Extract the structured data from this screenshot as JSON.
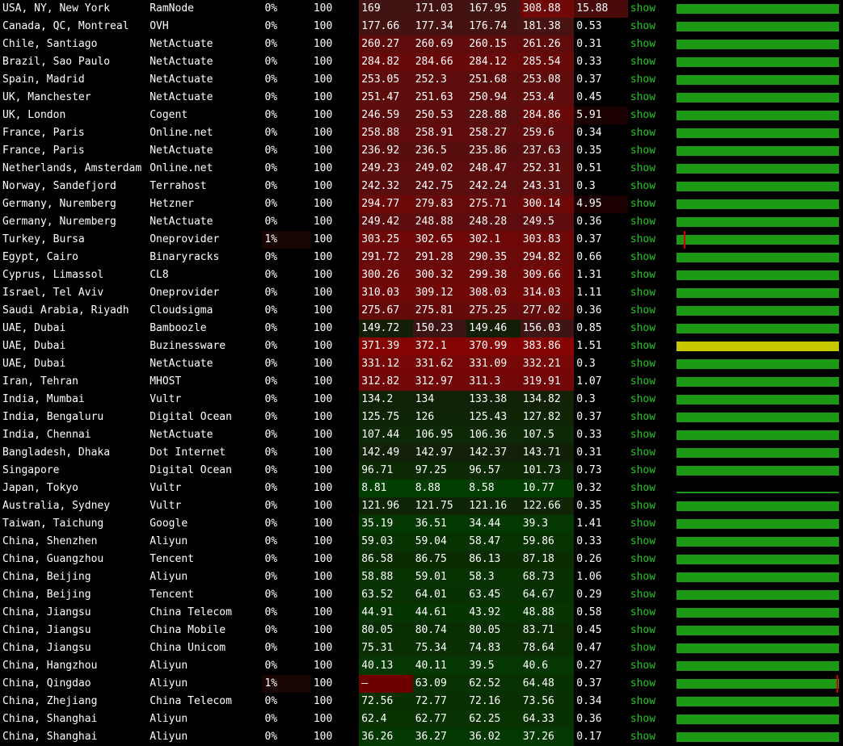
{
  "colors": {
    "background": "#000000",
    "text": "#ffffff",
    "link": "#22c91f",
    "graph_ok": "#1c9a16",
    "graph_high": "#c8c800",
    "graph_loss": "#d40000"
  },
  "rows": [
    {
      "location": "USA, NY, New York",
      "provider": "RamNode",
      "loss": "0%",
      "sent": "100",
      "last": "169",
      "avg": "171.03",
      "best": "167.95",
      "worst": "308.88",
      "stdev": "15.88",
      "link": "show"
    },
    {
      "location": "Canada, QC, Montreal",
      "provider": "OVH",
      "loss": "0%",
      "sent": "100",
      "last": "177.66",
      "avg": "177.34",
      "best": "176.74",
      "worst": "181.38",
      "stdev": "0.53",
      "link": "show"
    },
    {
      "location": "Chile, Santiago",
      "provider": "NetActuate",
      "loss": "0%",
      "sent": "100",
      "last": "260.27",
      "avg": "260.69",
      "best": "260.15",
      "worst": "261.26",
      "stdev": "0.31",
      "link": "show"
    },
    {
      "location": "Brazil, Sao Paulo",
      "provider": "NetActuate",
      "loss": "0%",
      "sent": "100",
      "last": "284.82",
      "avg": "284.66",
      "best": "284.12",
      "worst": "285.54",
      "stdev": "0.33",
      "link": "show"
    },
    {
      "location": "Spain, Madrid",
      "provider": "NetActuate",
      "loss": "0%",
      "sent": "100",
      "last": "253.05",
      "avg": "252.3",
      "best": "251.68",
      "worst": "253.08",
      "stdev": "0.37",
      "link": "show"
    },
    {
      "location": "UK, Manchester",
      "provider": "NetActuate",
      "loss": "0%",
      "sent": "100",
      "last": "251.47",
      "avg": "251.63",
      "best": "250.94",
      "worst": "253.4",
      "stdev": "0.45",
      "link": "show"
    },
    {
      "location": "UK, London",
      "provider": "Cogent",
      "loss": "0%",
      "sent": "100",
      "last": "246.59",
      "avg": "250.53",
      "best": "228.88",
      "worst": "284.86",
      "stdev": "5.91",
      "link": "show"
    },
    {
      "location": "France, Paris",
      "provider": "Online.net",
      "loss": "0%",
      "sent": "100",
      "last": "258.88",
      "avg": "258.91",
      "best": "258.27",
      "worst": "259.6",
      "stdev": "0.34",
      "link": "show"
    },
    {
      "location": "France, Paris",
      "provider": "NetActuate",
      "loss": "0%",
      "sent": "100",
      "last": "236.92",
      "avg": "236.5",
      "best": "235.86",
      "worst": "237.63",
      "stdev": "0.35",
      "link": "show"
    },
    {
      "location": "Netherlands, Amsterdam",
      "provider": "Online.net",
      "loss": "0%",
      "sent": "100",
      "last": "249.23",
      "avg": "249.02",
      "best": "248.47",
      "worst": "252.31",
      "stdev": "0.51",
      "link": "show"
    },
    {
      "location": "Norway, Sandefjord",
      "provider": "Terrahost",
      "loss": "0%",
      "sent": "100",
      "last": "242.32",
      "avg": "242.75",
      "best": "242.24",
      "worst": "243.31",
      "stdev": "0.3",
      "link": "show"
    },
    {
      "location": "Germany, Nuremberg",
      "provider": "Hetzner",
      "loss": "0%",
      "sent": "100",
      "last": "294.77",
      "avg": "279.83",
      "best": "275.71",
      "worst": "300.14",
      "stdev": "4.95",
      "link": "show"
    },
    {
      "location": "Germany, Nuremberg",
      "provider": "NetActuate",
      "loss": "0%",
      "sent": "100",
      "last": "249.42",
      "avg": "248.88",
      "best": "248.28",
      "worst": "249.5",
      "stdev": "0.36",
      "link": "show"
    },
    {
      "location": "Turkey, Bursa",
      "provider": "Oneprovider",
      "loss": "1%",
      "sent": "100",
      "last": "303.25",
      "avg": "302.65",
      "best": "302.1",
      "worst": "303.83",
      "stdev": "0.37",
      "link": "show"
    },
    {
      "location": "Egypt, Cairo",
      "provider": "Binaryracks",
      "loss": "0%",
      "sent": "100",
      "last": "291.72",
      "avg": "291.28",
      "best": "290.35",
      "worst": "294.82",
      "stdev": "0.66",
      "link": "show"
    },
    {
      "location": "Cyprus, Limassol",
      "provider": "CL8",
      "loss": "0%",
      "sent": "100",
      "last": "300.26",
      "avg": "300.32",
      "best": "299.38",
      "worst": "309.66",
      "stdev": "1.31",
      "link": "show"
    },
    {
      "location": "Israel, Tel Aviv",
      "provider": "Oneprovider",
      "loss": "0%",
      "sent": "100",
      "last": "310.03",
      "avg": "309.12",
      "best": "308.03",
      "worst": "314.03",
      "stdev": "1.11",
      "link": "show"
    },
    {
      "location": "Saudi Arabia, Riyadh",
      "provider": "Cloudsigma",
      "loss": "0%",
      "sent": "100",
      "last": "275.67",
      "avg": "275.81",
      "best": "275.25",
      "worst": "277.02",
      "stdev": "0.36",
      "link": "show"
    },
    {
      "location": "UAE, Dubai",
      "provider": "Bamboozle",
      "loss": "0%",
      "sent": "100",
      "last": "149.72",
      "avg": "150.23",
      "best": "149.46",
      "worst": "156.03",
      "stdev": "0.85",
      "link": "show"
    },
    {
      "location": "UAE, Dubai",
      "provider": "Buzinessware",
      "loss": "0%",
      "sent": "100",
      "last": "371.39",
      "avg": "372.1",
      "best": "370.99",
      "worst": "383.86",
      "stdev": "1.51",
      "link": "show"
    },
    {
      "location": "UAE, Dubai",
      "provider": "NetActuate",
      "loss": "0%",
      "sent": "100",
      "last": "331.12",
      "avg": "331.62",
      "best": "331.09",
      "worst": "332.21",
      "stdev": "0.3",
      "link": "show"
    },
    {
      "location": "Iran, Tehran",
      "provider": "MHOST",
      "loss": "0%",
      "sent": "100",
      "last": "312.82",
      "avg": "312.97",
      "best": "311.3",
      "worst": "319.91",
      "stdev": "1.07",
      "link": "show"
    },
    {
      "location": "India, Mumbai",
      "provider": "Vultr",
      "loss": "0%",
      "sent": "100",
      "last": "134.2",
      "avg": "134",
      "best": "133.38",
      "worst": "134.82",
      "stdev": "0.3",
      "link": "show"
    },
    {
      "location": "India, Bengaluru",
      "provider": "Digital Ocean",
      "loss": "0%",
      "sent": "100",
      "last": "125.75",
      "avg": "126",
      "best": "125.43",
      "worst": "127.82",
      "stdev": "0.37",
      "link": "show"
    },
    {
      "location": "India, Chennai",
      "provider": "NetActuate",
      "loss": "0%",
      "sent": "100",
      "last": "107.44",
      "avg": "106.95",
      "best": "106.36",
      "worst": "107.5",
      "stdev": "0.33",
      "link": "show"
    },
    {
      "location": "Bangladesh, Dhaka",
      "provider": "Dot Internet",
      "loss": "0%",
      "sent": "100",
      "last": "142.49",
      "avg": "142.97",
      "best": "142.37",
      "worst": "143.71",
      "stdev": "0.31",
      "link": "show"
    },
    {
      "location": "Singapore",
      "provider": "Digital Ocean",
      "loss": "0%",
      "sent": "100",
      "last": "96.71",
      "avg": "97.25",
      "best": "96.57",
      "worst": "101.73",
      "stdev": "0.73",
      "link": "show"
    },
    {
      "location": "Japan, Tokyo",
      "provider": "Vultr",
      "loss": "0%",
      "sent": "100",
      "last": "8.81",
      "avg": "8.88",
      "best": "8.58",
      "worst": "10.77",
      "stdev": "0.32",
      "link": "show"
    },
    {
      "location": "Australia, Sydney",
      "provider": "Vultr",
      "loss": "0%",
      "sent": "100",
      "last": "121.96",
      "avg": "121.75",
      "best": "121.16",
      "worst": "122.66",
      "stdev": "0.35",
      "link": "show"
    },
    {
      "location": "Taiwan, Taichung",
      "provider": "Google",
      "loss": "0%",
      "sent": "100",
      "last": "35.19",
      "avg": "36.51",
      "best": "34.44",
      "worst": "39.3",
      "stdev": "1.41",
      "link": "show"
    },
    {
      "location": "China, Shenzhen",
      "provider": "Aliyun",
      "loss": "0%",
      "sent": "100",
      "last": "59.03",
      "avg": "59.04",
      "best": "58.47",
      "worst": "59.86",
      "stdev": "0.33",
      "link": "show"
    },
    {
      "location": "China, Guangzhou",
      "provider": "Tencent",
      "loss": "0%",
      "sent": "100",
      "last": "86.58",
      "avg": "86.75",
      "best": "86.13",
      "worst": "87.18",
      "stdev": "0.26",
      "link": "show"
    },
    {
      "location": "China, Beijing",
      "provider": "Aliyun",
      "loss": "0%",
      "sent": "100",
      "last": "58.88",
      "avg": "59.01",
      "best": "58.3",
      "worst": "68.73",
      "stdev": "1.06",
      "link": "show"
    },
    {
      "location": "China, Beijing",
      "provider": "Tencent",
      "loss": "0%",
      "sent": "100",
      "last": "63.52",
      "avg": "64.01",
      "best": "63.45",
      "worst": "64.67",
      "stdev": "0.29",
      "link": "show"
    },
    {
      "location": "China, Jiangsu",
      "provider": "China Telecom",
      "loss": "0%",
      "sent": "100",
      "last": "44.91",
      "avg": "44.61",
      "best": "43.92",
      "worst": "48.88",
      "stdev": "0.58",
      "link": "show"
    },
    {
      "location": "China, Jiangsu",
      "provider": "China Mobile",
      "loss": "0%",
      "sent": "100",
      "last": "80.05",
      "avg": "80.74",
      "best": "80.05",
      "worst": "83.71",
      "stdev": "0.45",
      "link": "show"
    },
    {
      "location": "China, Jiangsu",
      "provider": "China Unicom",
      "loss": "0%",
      "sent": "100",
      "last": "75.31",
      "avg": "75.34",
      "best": "74.83",
      "worst": "78.64",
      "stdev": "0.47",
      "link": "show"
    },
    {
      "location": "China, Hangzhou",
      "provider": "Aliyun",
      "loss": "0%",
      "sent": "100",
      "last": "40.13",
      "avg": "40.11",
      "best": "39.5",
      "worst": "40.6",
      "stdev": "0.27",
      "link": "show"
    },
    {
      "location": "China, Qingdao",
      "provider": "Aliyun",
      "loss": "1%",
      "sent": "100",
      "last": "–",
      "avg": "63.09",
      "best": "62.52",
      "worst": "64.48",
      "stdev": "0.37",
      "link": "show"
    },
    {
      "location": "China, Zhejiang",
      "provider": "China Telecom",
      "loss": "0%",
      "sent": "100",
      "last": "72.56",
      "avg": "72.77",
      "best": "72.16",
      "worst": "73.56",
      "stdev": "0.34",
      "link": "show"
    },
    {
      "location": "China, Shanghai",
      "provider": "Aliyun",
      "loss": "0%",
      "sent": "100",
      "last": "62.4",
      "avg": "62.77",
      "best": "62.25",
      "worst": "64.33",
      "stdev": "0.36",
      "link": "show"
    },
    {
      "location": "China, Shanghai",
      "provider": "Aliyun",
      "loss": "0%",
      "sent": "100",
      "last": "36.26",
      "avg": "36.27",
      "best": "36.02",
      "worst": "37.26",
      "stdev": "0.17",
      "link": "show"
    }
  ]
}
